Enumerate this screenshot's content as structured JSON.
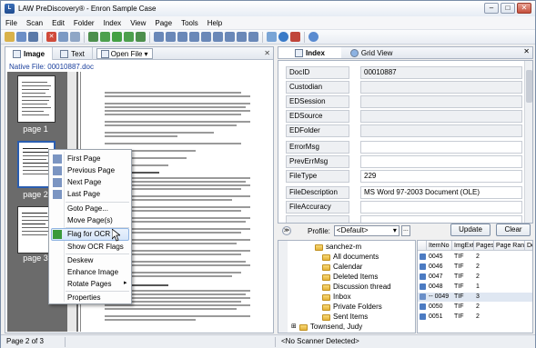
{
  "window": {
    "title": "LAW PreDiscovery® - Enron Sample Case"
  },
  "menu": [
    {
      "label": "File",
      "key": "F",
      "rest": "ile"
    },
    {
      "label": "Scan",
      "key": "S",
      "rest": "can"
    },
    {
      "label": "Edit",
      "key": "E",
      "rest": "dit"
    },
    {
      "label": "Folder",
      "key": "o",
      "pre": "F",
      "rest": "lder"
    },
    {
      "label": "Index",
      "key": "I",
      "rest": "ndex"
    },
    {
      "label": "View",
      "key": "V",
      "rest": "iew"
    },
    {
      "label": "Page",
      "key": "P",
      "rest": "age"
    },
    {
      "label": "Tools",
      "key": "T",
      "rest": "ools"
    },
    {
      "label": "Help",
      "key": "H",
      "rest": "elp"
    }
  ],
  "left": {
    "tabs": {
      "image": "Image",
      "text": "Text",
      "open_file": "Open File"
    },
    "native_file_label": "Native File:",
    "native_file_value": "00010887.doc",
    "thumbs": [
      "page 1",
      "page 2",
      "page 3"
    ]
  },
  "context_menu": {
    "items": [
      "First Page",
      "Previous Page",
      "Next Page",
      "Last Page",
      "Goto Page...",
      "Move Page(s)",
      "Flag for OCR",
      "Show OCR Flags",
      "Deskew",
      "Enhance Image",
      "Rotate Pages",
      "Properties"
    ],
    "highlighted": "Flag for OCR"
  },
  "right": {
    "tabs": {
      "index": "Index",
      "grid": "Grid View"
    },
    "fields": [
      {
        "name": "DocID",
        "value": "00010887"
      },
      {
        "name": "Custodian",
        "value": ""
      },
      {
        "name": "EDSession",
        "value": ""
      },
      {
        "name": "EDSource",
        "value": ""
      },
      {
        "name": "EDFolder",
        "value": ""
      },
      {
        "name": "ErrorMsg",
        "value": ""
      },
      {
        "name": "PrevErrMsg",
        "value": ""
      },
      {
        "name": "FileType",
        "value": "229"
      },
      {
        "name": "FileDescription",
        "value": "MS Word 97-2003 Document (OLE)"
      },
      {
        "name": "FileAccuracy",
        "value": ""
      },
      {
        "name": "",
        "value": ""
      }
    ],
    "profile_label": "Profile:",
    "profile_value": "<Default>",
    "dots": "...",
    "update_label": "Update",
    "clear_label": "Clear"
  },
  "tree": {
    "items": [
      {
        "label": "sanchez-m",
        "indent": 0
      },
      {
        "label": "All documents",
        "indent": 1
      },
      {
        "label": "Calendar",
        "indent": 1
      },
      {
        "label": "Deleted Items",
        "indent": 1
      },
      {
        "label": "Discussion thread",
        "indent": 1
      },
      {
        "label": "Inbox",
        "indent": 1
      },
      {
        "label": "Private Folders",
        "indent": 1
      },
      {
        "label": "Sent Items",
        "indent": 1
      },
      {
        "label": "Townsend, Judy",
        "indent": 0
      }
    ]
  },
  "table": {
    "headers": [
      "ItemNo",
      "ImgExt",
      "Pages",
      "Page Range",
      "DocID"
    ],
    "rows": [
      {
        "item": "0045",
        "ext": "TIF",
        "pages": "2",
        "range": "",
        "docid": ""
      },
      {
        "item": "0046",
        "ext": "TIF",
        "pages": "2",
        "range": "",
        "docid": ""
      },
      {
        "item": "0047",
        "ext": "TIF",
        "pages": "2",
        "range": "",
        "docid": ""
      },
      {
        "item": "0048",
        "ext": "TIF",
        "pages": "1",
        "range": "",
        "docid": ""
      },
      {
        "item": "-- 0049",
        "ext": "TIF",
        "pages": "3",
        "range": "",
        "docid": ""
      },
      {
        "item": "0050",
        "ext": "TIF",
        "pages": "2",
        "range": "",
        "docid": ""
      },
      {
        "item": "0051",
        "ext": "TIF",
        "pages": "2",
        "range": "",
        "docid": ""
      }
    ]
  },
  "status": {
    "page": "Page 2 of 3",
    "scanner": "<No Scanner Detected>"
  },
  "colors": {
    "accent": "#3b6fb8",
    "highlight": "#d6e6fa",
    "thumb_bg": "#6b6b6b"
  }
}
